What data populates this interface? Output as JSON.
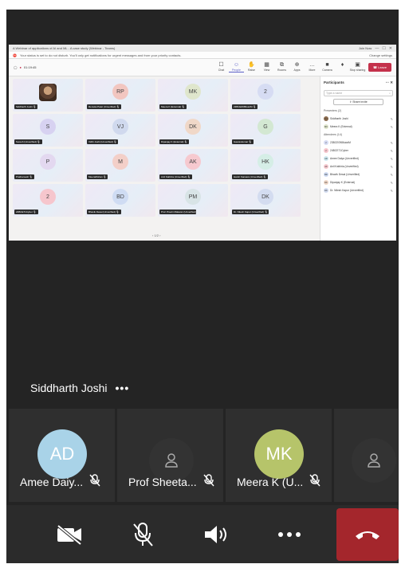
{
  "shared_screen": {
    "window_title": "A Webinar of applications of AI and ML - A case study (Webinar - Teams)",
    "window_badge": "Join Now",
    "status_banner": "Your status is set to do not disturb. You'll only get notifications for urgent messages and from your priority contacts.",
    "change_settings": "Change settings",
    "timer": "01:19:45",
    "toolbar": [
      {
        "label": "Chat",
        "icon": "chat-icon",
        "glyph": "☐"
      },
      {
        "label": "People",
        "icon": "people-icon",
        "glyph": "☺"
      },
      {
        "label": "Raise",
        "icon": "hand-icon",
        "glyph": "✋"
      },
      {
        "label": "View",
        "icon": "view-icon",
        "glyph": "▦"
      },
      {
        "label": "Rooms",
        "icon": "rooms-icon",
        "glyph": "⧉"
      },
      {
        "label": "Apps",
        "icon": "apps-icon",
        "glyph": "⊕"
      },
      {
        "label": "More",
        "icon": "more-icon",
        "glyph": "…"
      },
      {
        "label": "Camera",
        "icon": "camera-icon",
        "glyph": "■"
      },
      {
        "label": "",
        "icon": "mic-icon",
        "glyph": "♦"
      },
      {
        "label": "Stop sharing",
        "icon": "share-icon",
        "glyph": "▣"
      }
    ],
    "leave_label": "Leave",
    "grid": [
      {
        "initials": "",
        "name": "Siddharth Joshi",
        "color": "#8a6a4c",
        "photo": true
      },
      {
        "initials": "RP",
        "name": "Renuka Patel (Unverified)",
        "color": "#f2c6c0"
      },
      {
        "initials": "MK",
        "name": "Meera K (External)",
        "color": "#dfe6cc"
      },
      {
        "initials": "2",
        "name": "23BCE0986uiotM",
        "color": "#d6dcf3"
      },
      {
        "initials": "S",
        "name": "Suresh (Unverified)",
        "color": "#d7d2f1"
      },
      {
        "initials": "VJ",
        "name": "Vidhi Joshi (Unverified)",
        "color": "#d0d9ee"
      },
      {
        "initials": "DK",
        "name": "Dipanjay K (External)",
        "color": "#f0d8c8"
      },
      {
        "initials": "G",
        "name": "Gauravkumar",
        "color": "#d3e8d2"
      },
      {
        "initials": "P",
        "name": "Prathamesh",
        "color": "#e3d8f0"
      },
      {
        "initials": "M",
        "name": "MeeraMohan",
        "color": "#f3cfc8"
      },
      {
        "initials": "AK",
        "name": "Anil Kathiria (Unverified)",
        "color": "#f6c9cf"
      },
      {
        "initials": "HK",
        "name": "Harsh Kansara (Unverified)",
        "color": "#d5eee6"
      },
      {
        "initials": "2",
        "name": "24BCE71Cyber",
        "color": "#f6c6cd"
      },
      {
        "initials": "BD",
        "name": "Bhavik Desai (Unverified)",
        "color": "#cfdcf3"
      },
      {
        "initials": "PM",
        "name": "Prof. Pravin Makwan (Unverified)",
        "color": "#d8e4e6"
      },
      {
        "initials": "DK",
        "name": "Dr. Nilesh Kapur (Unverified)",
        "color": "#d3dcf0"
      }
    ],
    "pager": "‹  1/2  ›",
    "panel": {
      "title": "Participants",
      "search_placeholder": "Type a name",
      "share_invite": "Share invite",
      "presenters_header": "Presenters (2)",
      "presenters": [
        {
          "initials": "SJ",
          "name": "Siddharth Joshi",
          "color": "#8a6a4c"
        },
        {
          "initials": "MK",
          "name": "Meera K (External)",
          "color": "#dfe6cc"
        }
      ],
      "attendees_header": "Attendees (14)",
      "attendees": [
        {
          "initials": "2",
          "name": "23BCE0986uiotM",
          "color": "#d6dcf3"
        },
        {
          "initials": "2",
          "name": "24BCE71Cyber",
          "color": "#f6c6cd"
        },
        {
          "initials": "AD",
          "name": "Amee Daiya (Unverified)",
          "color": "#cde8f0"
        },
        {
          "initials": "AK",
          "name": "Anil Kathiria (Unverified)",
          "color": "#f6c9cf"
        },
        {
          "initials": "BD",
          "name": "Bhavik Desai (Unverified)",
          "color": "#cfdcf3"
        },
        {
          "initials": "DK",
          "name": "Dipanjay K (External)",
          "color": "#f0d8c8"
        },
        {
          "initials": "DK",
          "name": "Dr. Nilesh Kapur (Unverified)",
          "color": "#d3dcf0"
        }
      ]
    }
  },
  "presenter_caption": "Siddharth Joshi",
  "participants_strip": [
    {
      "initials": "AD",
      "name": "Amee Daiy...",
      "color": "#a9d3e8",
      "has_avatar": true
    },
    {
      "initials": "",
      "name": "Prof Sheeta...",
      "color": "",
      "has_avatar": false
    },
    {
      "initials": "MK",
      "name": "Meera K (U...",
      "color": "#b6c46a",
      "has_avatar": true
    },
    {
      "initials": "",
      "name": "",
      "color": "",
      "has_avatar": false
    }
  ],
  "controls": {
    "camera": "camera-off-icon",
    "mic": "mic-off-icon",
    "speaker": "speaker-icon",
    "more": "more-icon",
    "hangup": "hang-up-icon"
  },
  "colors": {
    "hangup": "#a4262c",
    "background": "#242424",
    "accent": "#5b5fc7"
  }
}
